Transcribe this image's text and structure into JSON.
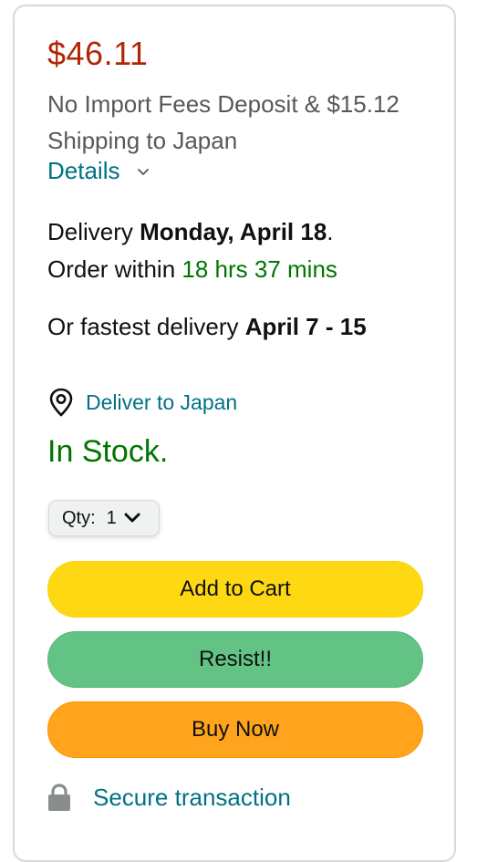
{
  "price": "$46.11",
  "fees": "No Import Fees Deposit & $15.12 Shipping to Japan",
  "details_label": "Details",
  "delivery": {
    "prefix": "Delivery ",
    "date": "Monday, April 18",
    "suffix": ".",
    "order_prefix": "Order within ",
    "order_time": "18 hrs 37 mins"
  },
  "fastest": {
    "prefix": "Or fastest delivery ",
    "date": "April 7 - 15"
  },
  "deliver_to": "Deliver to Japan",
  "stock": "In Stock.",
  "qty": {
    "label": "Qty:",
    "value": "1"
  },
  "buttons": {
    "add_to_cart": "Add to Cart",
    "resist": "Resist!!",
    "buy_now": "Buy Now"
  },
  "secure": "Secure transaction",
  "colors": {
    "price": "#b12704",
    "link": "#007185",
    "stock_green": "#007600",
    "add_to_cart": "#ffd814",
    "resist": "#63c384",
    "buy_now": "#ffa41c"
  },
  "icons": {
    "details_chevron": "chevron-down-icon",
    "location": "location-pin-icon",
    "qty_chevron": "chevron-down-icon",
    "secure": "lock-icon"
  }
}
